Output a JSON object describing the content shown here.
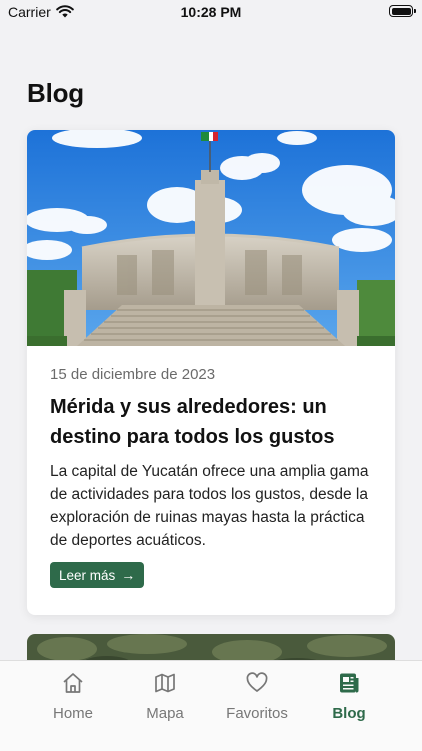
{
  "status_bar": {
    "carrier": "Carrier",
    "time": "10:28 PM"
  },
  "page": {
    "title": "Blog"
  },
  "posts": [
    {
      "date": "15 de diciembre de 2023",
      "title": "Mérida y sus alrededores: un destino para todos los gustos",
      "excerpt": "La capital de Yucatán ofrece una amplia gama de actividades para todos los gustos, desde la exploración de ruinas mayas hasta la práctica de deportes acuáticos.",
      "read_more": "Leer más"
    }
  ],
  "tabbar": {
    "items": [
      {
        "label": "Home",
        "icon": "house-icon"
      },
      {
        "label": "Mapa",
        "icon": "map-icon"
      },
      {
        "label": "Favoritos",
        "icon": "heart-icon"
      },
      {
        "label": "Blog",
        "icon": "newspaper-icon",
        "active": true
      }
    ]
  },
  "colors": {
    "accent": "#2e6a4a",
    "inactive": "#777777",
    "background": "#f2f2f4"
  }
}
